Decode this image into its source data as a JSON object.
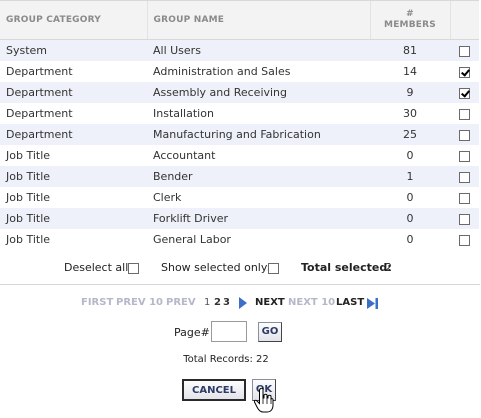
{
  "table": {
    "headers": {
      "category": "GROUP CATEGORY",
      "name": "GROUP NAME",
      "members_line1": "#",
      "members_line2": "MEMBERS"
    },
    "rows": [
      {
        "category": "System",
        "name": "All Users",
        "members": "81",
        "checked": false
      },
      {
        "category": "Department",
        "name": "Administration and Sales",
        "members": "14",
        "checked": true
      },
      {
        "category": "Department",
        "name": "Assembly and Receiving",
        "members": "9",
        "checked": true
      },
      {
        "category": "Department",
        "name": "Installation",
        "members": "30",
        "checked": false
      },
      {
        "category": "Department",
        "name": "Manufacturing and Fabrication",
        "members": "25",
        "checked": false
      },
      {
        "category": "Job Title",
        "name": "Accountant",
        "members": "0",
        "checked": false
      },
      {
        "category": "Job Title",
        "name": "Bender",
        "members": "1",
        "checked": false
      },
      {
        "category": "Job Title",
        "name": "Clerk",
        "members": "0",
        "checked": false
      },
      {
        "category": "Job Title",
        "name": "Forklift Driver",
        "members": "0",
        "checked": false
      },
      {
        "category": "Job Title",
        "name": "General Labor",
        "members": "0",
        "checked": false
      }
    ]
  },
  "selection": {
    "deselect_all_label": "Deselect all:",
    "show_selected_only_label": "Show selected only:",
    "total_selected_label": "Total selected:",
    "total_selected_value": "2"
  },
  "pager": {
    "first": "FIRST",
    "prev10": "PREV 10",
    "prev": "PREV",
    "page1": "1",
    "page2": "2",
    "page3": "3",
    "next": "NEXT",
    "next10": "NEXT 10",
    "last": "LAST",
    "page_num_label": "Page#",
    "page_num_value": "",
    "go_label": "GO",
    "total_records": "Total Records: 22"
  },
  "actions": {
    "cancel_label": "CANCEL",
    "ok_label": "OK"
  },
  "icons": {
    "next": "next-arrow-icon",
    "last": "last-arrow-icon",
    "cursor": "hand-pointer-icon"
  },
  "colors": {
    "row_alt": "#eef1f9",
    "link_blue": "#3b6fc9",
    "disabled": "#b4b8c8"
  }
}
